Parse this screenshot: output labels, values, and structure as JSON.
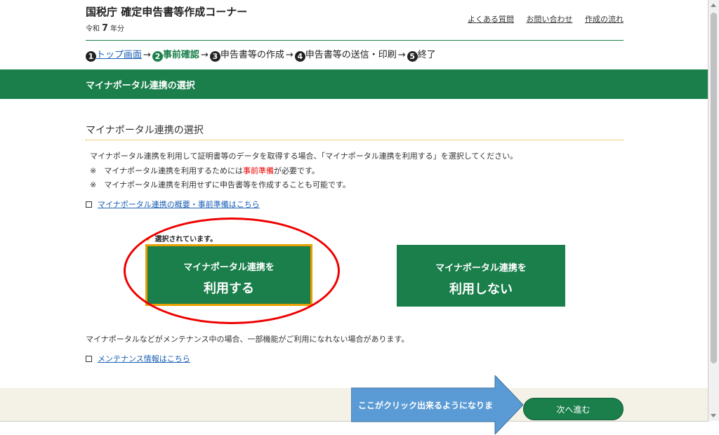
{
  "header": {
    "title": "国税庁 確定申告書等作成コーナー",
    "era_prefix": "令和",
    "era_year": "7",
    "era_suffix": "年分",
    "links": [
      "よくある質問",
      "お問い合わせ",
      "作成の流れ"
    ]
  },
  "steps": [
    {
      "num": "1",
      "label": "トップ画面"
    },
    {
      "num": "2",
      "label": "事前確認"
    },
    {
      "num": "3",
      "label": "申告書等の作成"
    },
    {
      "num": "4",
      "label": "申告書等の送信・印刷"
    },
    {
      "num": "5",
      "label": "終了"
    }
  ],
  "banner": {
    "title": "マイナポータル連携の選択"
  },
  "section": {
    "title": "マイナポータル連携の選択",
    "desc1": "マイナポータル連携を利用して証明書等のデータを取得する場合、「マイナポータル連携を利用する」を選択してください。",
    "desc2_prefix": "※　マイナポータル連携を利用するためには",
    "desc2_red": "事前準備",
    "desc2_suffix": "が必要です。",
    "desc3": "※　マイナポータル連携を利用せずに申告書等を作成することも可能です。",
    "link1": "マイナポータル連携の概要・事前準備はこちら"
  },
  "choices": {
    "selected_note": "選択されています。",
    "use_line1": "マイナポータル連携を",
    "use_line2": "利用する",
    "nouse_line1": "マイナポータル連携を",
    "nouse_line2": "利用しない"
  },
  "maintenance": {
    "text": "マイナポータルなどがメンテナンス中の場合、一部機能がご利用になれない場合があります。",
    "link": "メンテナンス情報はこちら"
  },
  "callout": {
    "text": "ここがクリック出来るようになりま"
  },
  "footer": {
    "next_label": "次へ進む"
  },
  "colors": {
    "green": "#1a7f4b",
    "orange": "#e8a000",
    "red": "#e00000",
    "callout_blue": "#5b9bd5"
  }
}
